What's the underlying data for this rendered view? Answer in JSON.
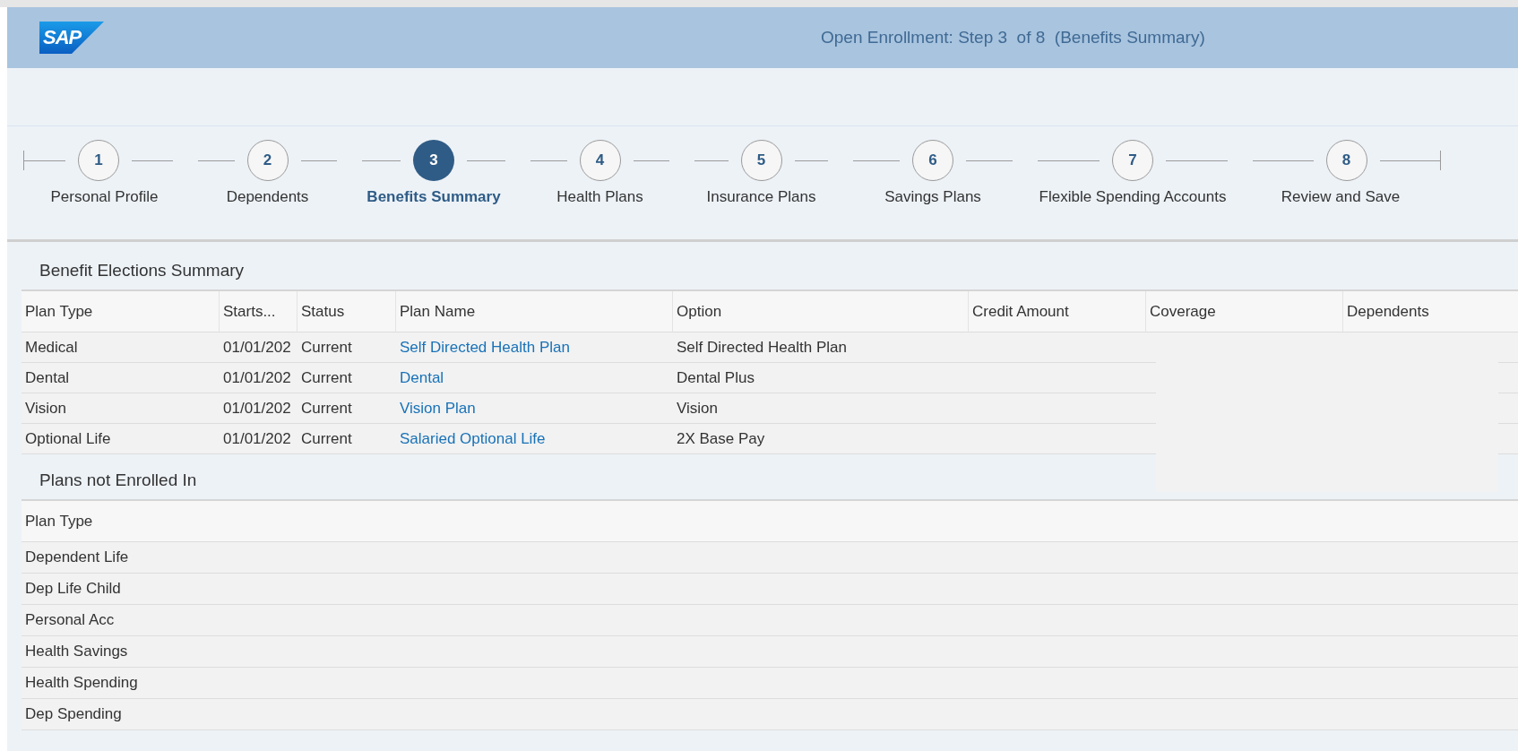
{
  "header": {
    "logo": "SAP",
    "title": "Open Enrollment: Step 3  of 8  (Benefits Summary)"
  },
  "steps": [
    {
      "number": "1",
      "label": "Personal Profile",
      "selected": false
    },
    {
      "number": "2",
      "label": "Dependents",
      "selected": false
    },
    {
      "number": "3",
      "label": "Benefits Summary",
      "selected": true
    },
    {
      "number": "4",
      "label": "Health Plans",
      "selected": false
    },
    {
      "number": "5",
      "label": "Insurance Plans",
      "selected": false
    },
    {
      "number": "6",
      "label": "Savings Plans",
      "selected": false
    },
    {
      "number": "7",
      "label": "Flexible Spending Accounts",
      "selected": false
    },
    {
      "number": "8",
      "label": "Review and Save",
      "selected": false
    }
  ],
  "elections": {
    "title": "Benefit Elections Summary",
    "columns": [
      "Plan Type",
      "Starts...",
      "Status",
      "Plan Name",
      "Option",
      "Credit Amount",
      "Coverage",
      "Dependents"
    ],
    "rows": [
      {
        "plan_type": "Medical",
        "starts": "01/01/202",
        "status": "Current",
        "plan_name": "Self Directed Health Plan",
        "option": "Self Directed Health Plan"
      },
      {
        "plan_type": "Dental",
        "starts": "01/01/202",
        "status": "Current",
        "plan_name": "Dental",
        "option": "Dental Plus"
      },
      {
        "plan_type": "Vision",
        "starts": "01/01/202",
        "status": "Current",
        "plan_name": "Vision Plan",
        "option": "Vision"
      },
      {
        "plan_type": "Optional Life",
        "starts": "01/01/202",
        "status": "Current",
        "plan_name": "Salaried Optional Life",
        "option": "2X Base Pay"
      }
    ]
  },
  "not_enrolled": {
    "title": "Plans not Enrolled In",
    "columns": [
      "Plan Type"
    ],
    "rows": [
      "Dependent Life",
      "Dep Life Child",
      "Personal Acc",
      "Health Savings",
      "Health Spending",
      "Dep Spending"
    ]
  }
}
